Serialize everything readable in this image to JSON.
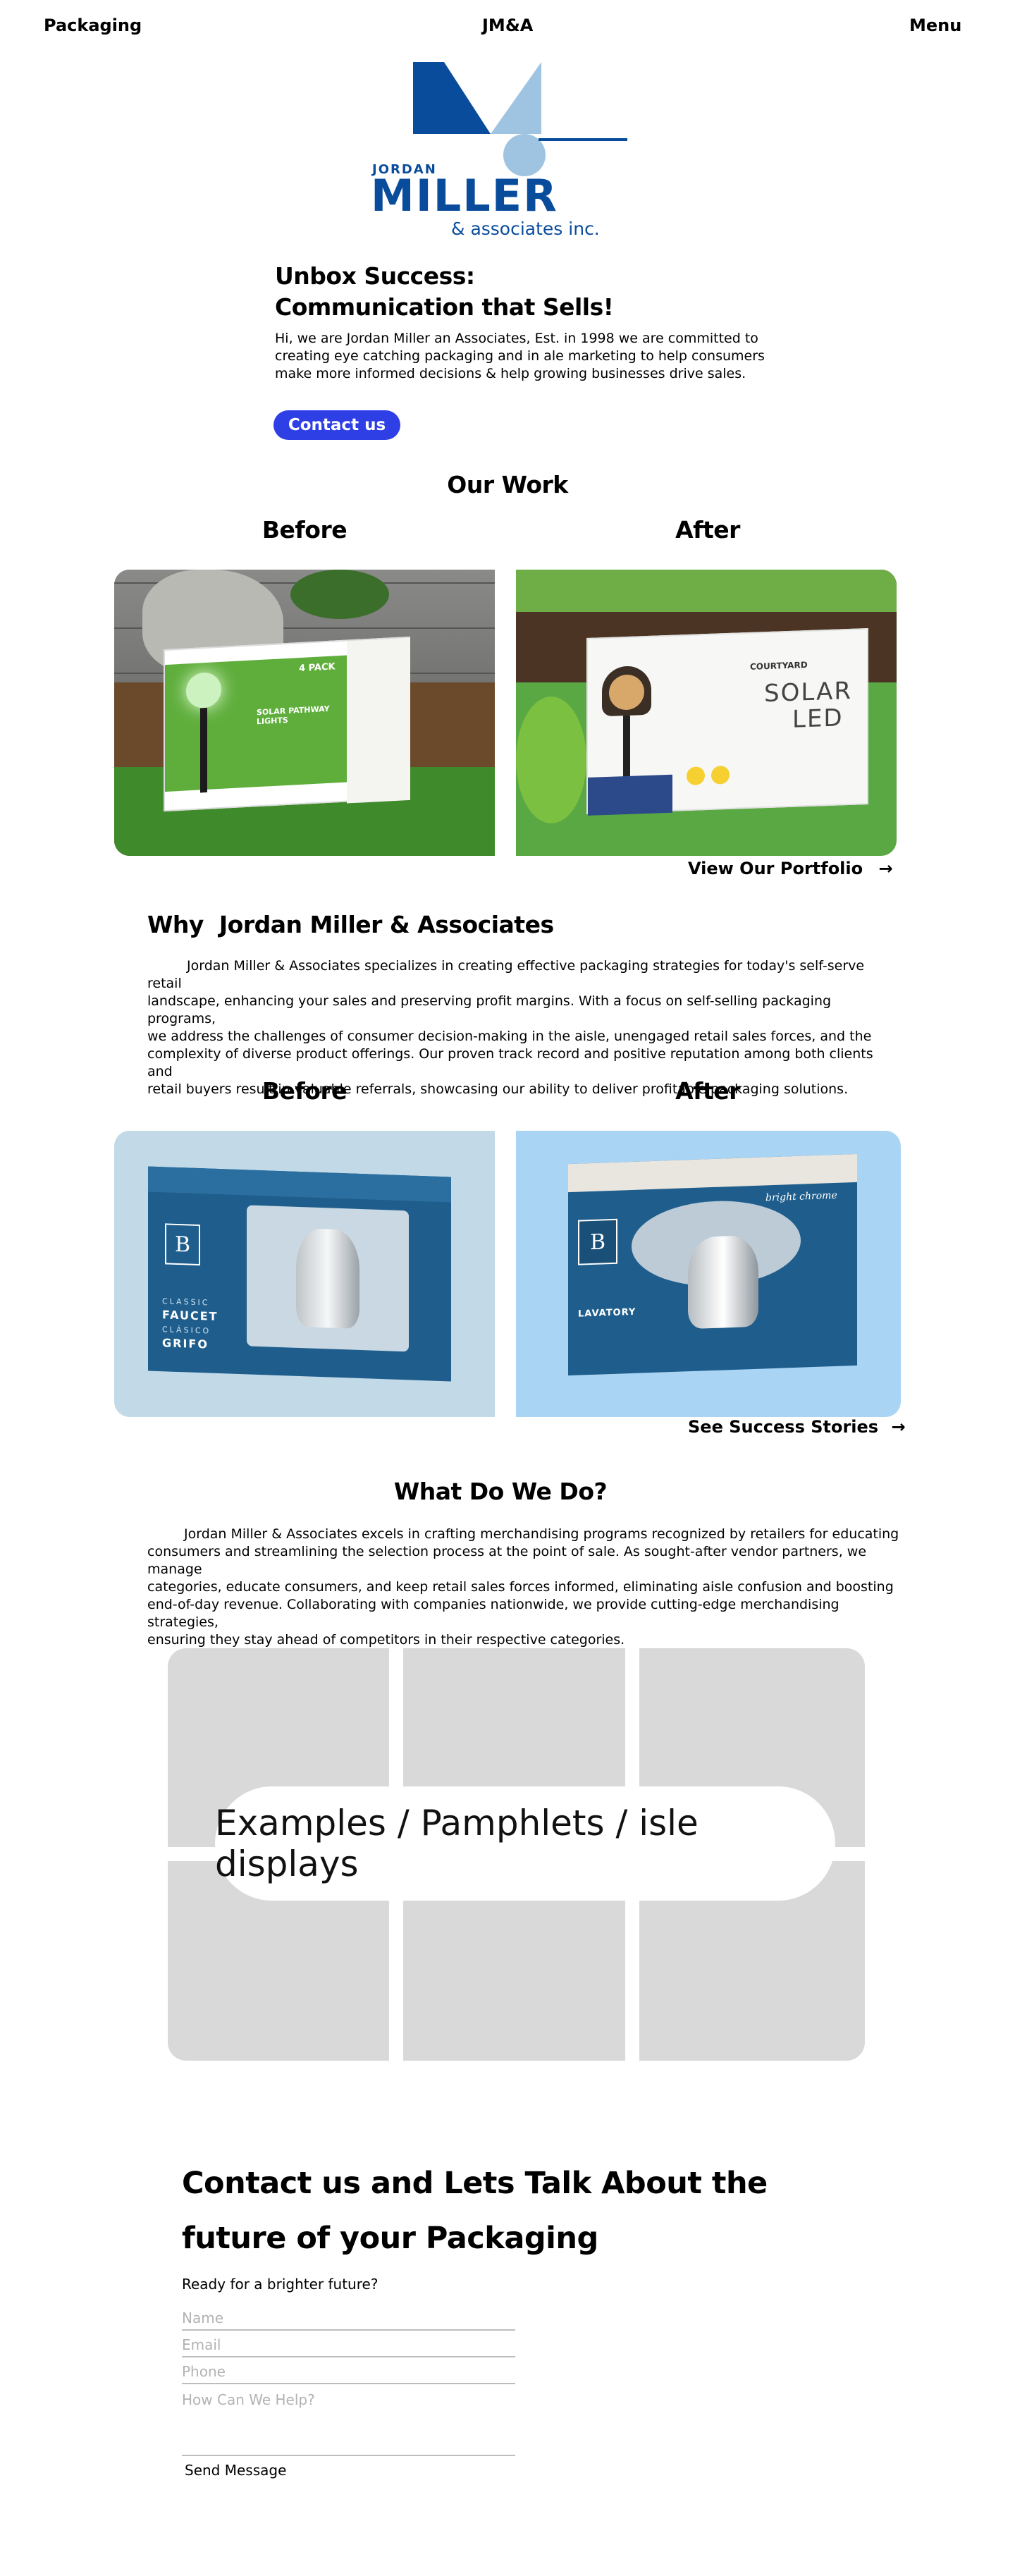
{
  "header": {
    "left_link": "Packaging",
    "center_title": "JM&A",
    "right_link": "Menu"
  },
  "logo": {
    "line1": "JORDAN",
    "line2": "MILLER",
    "line3": "& associates inc.",
    "colors": {
      "dark_blue": "#0a4c9c",
      "light_blue": "#9ec4e2"
    }
  },
  "hero": {
    "title_line1": "Unbox Success:",
    "title_line2": "Communication that Sells!",
    "intro_line1": "Hi, we are Jordan Miller an Associates, Est. in 1998 we are committed to",
    "intro_line2": "creating eye catching packaging and in ale marketing to help consumers",
    "intro_line3": "make more informed decisions & help growing businesses drive sales.",
    "cta_label": "Contact us",
    "cta_color": "#2f3fe6"
  },
  "our_work": {
    "heading": "Our Work",
    "before_label": "Before",
    "after_label": "After",
    "before_box": {
      "badge": "4 PACK",
      "title": "SOLAR PATHWAY LIGHTS"
    },
    "after_box": {
      "brand": "COURTYARD",
      "title1": "SOLAR",
      "title2": "LED"
    },
    "portfolio_link": "View Our Portfolio",
    "arrow": "→"
  },
  "why": {
    "heading": "Why  Jordan Miller & Associates",
    "paragraph_lines": [
      "Jordan Miller & Associates specializes in creating effective packaging strategies for today's self-serve retail",
      "landscape, enhancing your sales and preserving profit margins. With a focus on self-selling packaging programs,",
      "we address the challenges of consumer decision-making in the aisle, unengaged retail sales forces, and the",
      "complexity of diverse product offerings. Our proven track record and positive reputation among both clients and",
      "retail buyers result in valuable referrals, showcasing our ability to deliver profitable packaging solutions."
    ]
  },
  "faucet": {
    "before_label": "Before",
    "after_label": "After",
    "before_box": {
      "brand_letter": "B",
      "line1": "CLASSIC",
      "line2": "FAUCET",
      "line3": "CLÁSICO",
      "line4": "GRIFO"
    },
    "after_box": {
      "brand_letter": "B",
      "tag": "bright chrome",
      "line1": "LAVATORY"
    },
    "stories_link": "See Success Stories",
    "arrow": "→"
  },
  "what": {
    "heading": "What Do We Do?",
    "paragraph_lines": [
      "Jordan Miller & Associates excels in crafting merchandising programs recognized by retailers for educating",
      "consumers and streamlining the selection process at the point of sale. As sought-after vendor partners, we manage",
      "categories, educate consumers, and keep retail sales forces informed, eliminating aisle confusion and boosting",
      "end-of-day revenue. Collaborating with companies nationwide, we provide cutting-edge merchandising strategies,",
      "ensuring they stay ahead of competitors in their respective categories."
    ]
  },
  "examples": {
    "label": "Examples / Pamphlets / isle displays"
  },
  "contact": {
    "title_line1": "Contact us and Lets Talk About the",
    "title_line2": "future of your Packaging",
    "subtitle": "Ready for a brighter future?",
    "name_placeholder": "Name",
    "email_placeholder": "Email",
    "phone_placeholder": "Phone",
    "help_placeholder": "How Can We Help?",
    "send_label": "Send Message"
  }
}
